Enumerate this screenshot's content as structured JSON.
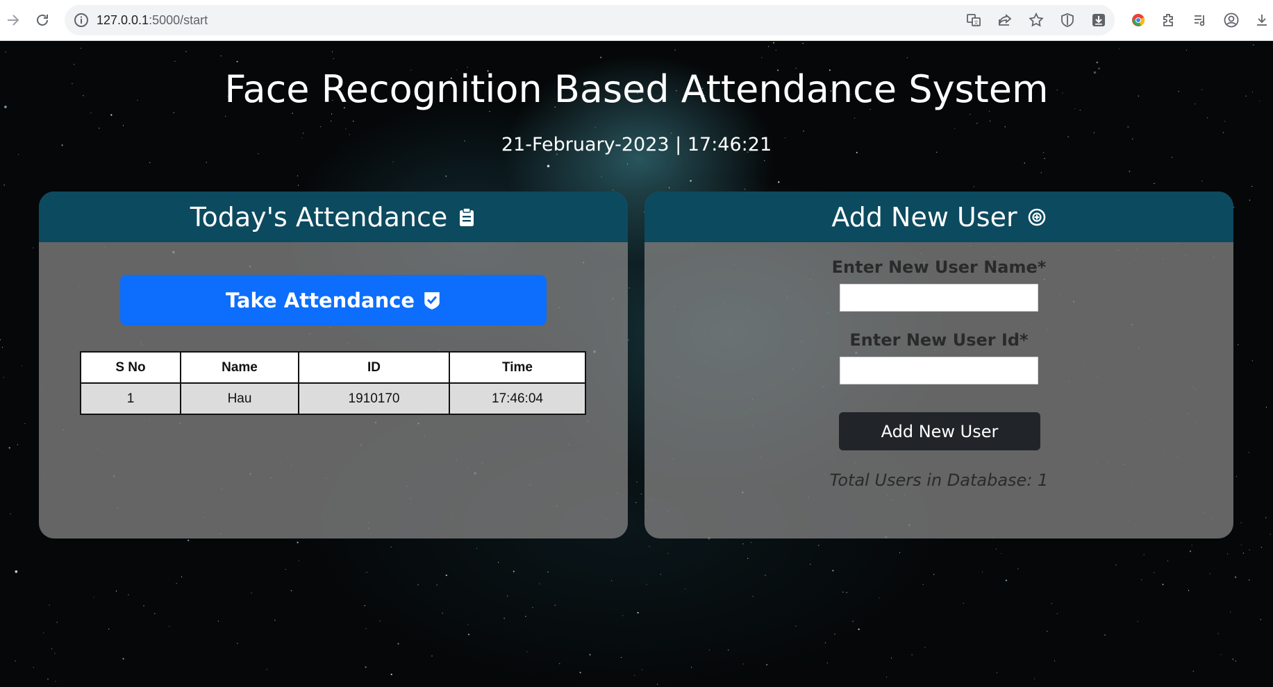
{
  "browser": {
    "url_host": "127.0.0.1",
    "url_path": ":5000/start"
  },
  "page": {
    "title": "Face Recognition Based Attendance System",
    "datetime": "21-February-2023 | 17:46:21"
  },
  "attendance": {
    "heading": "Today's Attendance",
    "take_button": "Take Attendance",
    "columns": [
      "S No",
      "Name",
      "ID",
      "Time"
    ],
    "rows": [
      [
        "1",
        "Hau",
        "1910170",
        "17:46:04"
      ]
    ]
  },
  "add_user": {
    "heading": "Add New User",
    "name_label": "Enter New User Name*",
    "name_value": "",
    "id_label": "Enter New User Id*",
    "id_value": "",
    "button": "Add New User",
    "total": "Total Users in Database: 1"
  },
  "colors": {
    "card_header": "#0c4a5f",
    "primary_button": "#0d6efd",
    "dark_button": "#212529"
  }
}
